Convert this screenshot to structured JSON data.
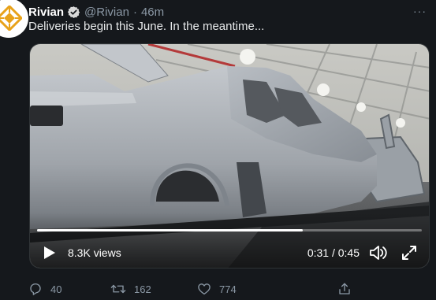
{
  "tweet": {
    "author_name": "Rivian",
    "handle": "@Rivian",
    "separator": "·",
    "time": "46m",
    "more": "···",
    "text": "Deliveries begin this June. In the meantime..."
  },
  "video": {
    "views": "8.3K views",
    "timecode": "0:31 / 0:45",
    "progress": 0.69
  },
  "actions": {
    "replies": "40",
    "retweets": "162",
    "likes": "774"
  },
  "colors": {
    "background": "#15181c",
    "avatar_brand": "#e8a21a",
    "verified": "#d9d9d9",
    "secondary_text": "#8b98a5"
  }
}
